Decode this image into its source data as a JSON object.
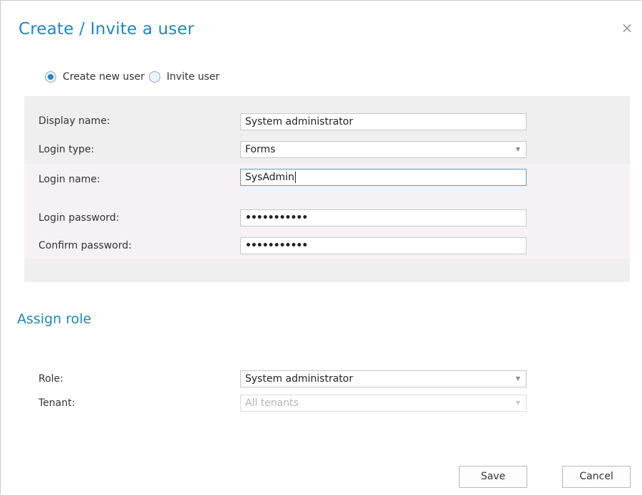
{
  "dialog": {
    "title": "Create / Invite a user",
    "close_symbol": "×"
  },
  "mode": {
    "options": [
      {
        "label": "Create new user",
        "checked": true
      },
      {
        "label": "Invite user",
        "checked": false
      }
    ]
  },
  "form": {
    "display_name": {
      "label": "Display name:",
      "value": "System administrator"
    },
    "login_type": {
      "label": "Login type:",
      "value": "Forms"
    },
    "login_name": {
      "label": "Login name:",
      "value": "SysAdmin"
    },
    "login_password": {
      "label": "Login password:",
      "value": "•••••••••••"
    },
    "confirm_password": {
      "label": "Confirm password:",
      "value": "•••••••••••"
    }
  },
  "assign_role": {
    "title": "Assign role",
    "role": {
      "label": "Role:",
      "value": "System administrator"
    },
    "tenant": {
      "label": "Tenant:",
      "value": "All tenants"
    }
  },
  "actions": {
    "save_label": "Save",
    "cancel_label": "Cancel"
  },
  "icons": {
    "dropdown_arrow": "▼"
  },
  "colors": {
    "accent": "#1f86c6",
    "panel_bg": "#efefef",
    "login_band_bg": "#f5f1f5",
    "focus_border": "#5b9bd5"
  }
}
